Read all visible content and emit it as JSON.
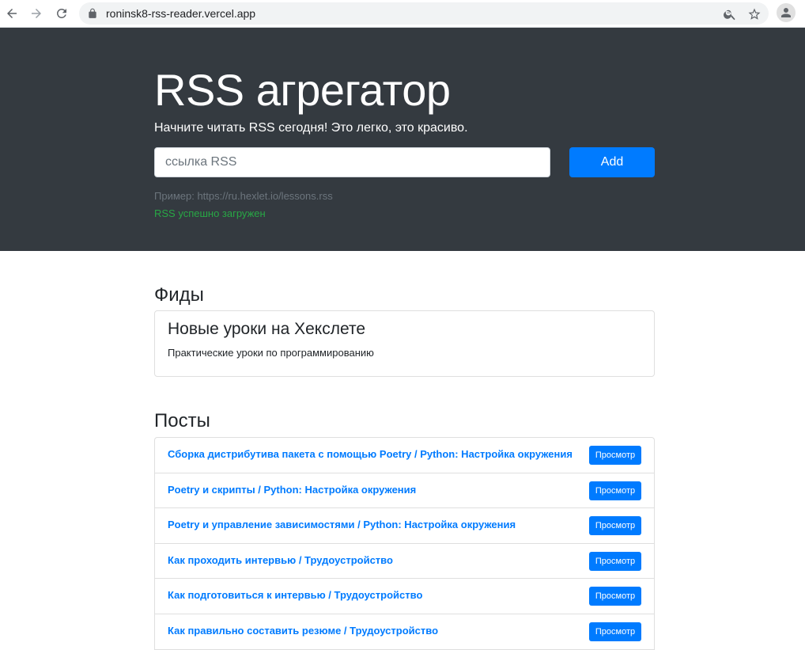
{
  "browser": {
    "url": "roninsk8-rss-reader.vercel.app",
    "icons": [
      "back-icon",
      "forward-icon",
      "reload-icon",
      "lock-icon",
      "zoom-icon",
      "star-icon",
      "profile-icon"
    ]
  },
  "hero": {
    "title": "RSS агрегатор",
    "lead": "Начните читать RSS сегодня! Это легко, это красиво.",
    "input_placeholder": "ссылка RSS",
    "input_value": "",
    "add_label": "Add",
    "example": "Пример: https://ru.hexlet.io/lessons.rss",
    "feedback": "RSS успешно загружен"
  },
  "feeds": {
    "title": "Фиды",
    "items": [
      {
        "name": "Новые уроки на Хекслете",
        "description": "Практические уроки по программированию"
      }
    ]
  },
  "posts": {
    "title": "Посты",
    "view_label": "Просмотр",
    "items": [
      {
        "title": "Сборка дистрибутива пакета с помощью Poetry / Python: Настройка окружения"
      },
      {
        "title": "Poetry и скрипты / Python: Настройка окружения"
      },
      {
        "title": "Poetry и управление зависимостями / Python: Настройка окружения"
      },
      {
        "title": "Как проходить интервью / Трудоустройство"
      },
      {
        "title": "Как подготовиться к интервью / Трудоустройство"
      },
      {
        "title": "Как правильно составить резюме / Трудоустройство"
      }
    ]
  },
  "colors": {
    "hero_bg": "#343a40",
    "primary": "#007bff",
    "success": "#28a745",
    "muted": "#6c757d"
  }
}
